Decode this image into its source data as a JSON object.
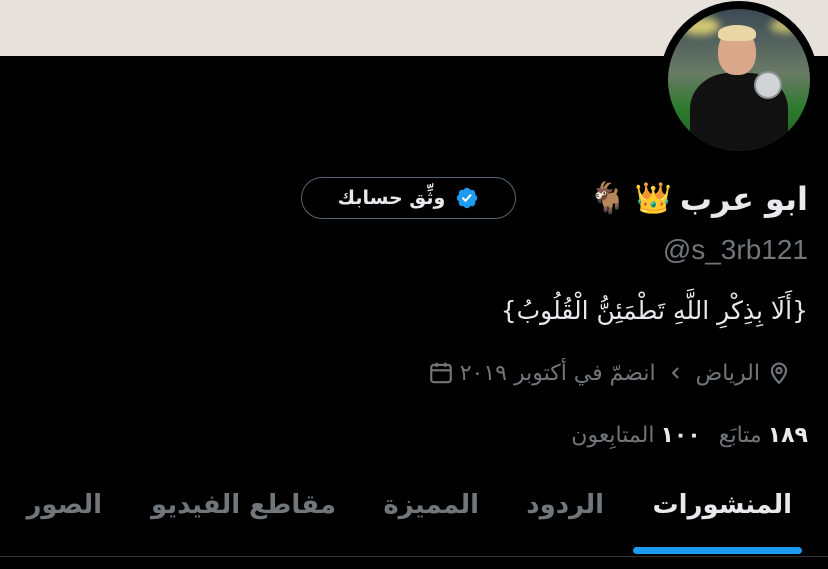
{
  "profile": {
    "display_name": "ابو عرب",
    "emoji_crown": "👑",
    "emoji_goat": "🐐",
    "handle": "@s_3rb121",
    "bio": "{أَلَا بِذِكْرِ اللَّهِ تَطْمَئِنُّ الْقُلُوبُ}",
    "location": "الرياض",
    "joined": "انضمّ في أكتوبر ٢٠١٩",
    "following_count": "١٨٩",
    "following_label": "متابَع",
    "followers_count": "١٠٠",
    "followers_label": "المتابِعون",
    "verify_button": "وثِّق حسابك"
  },
  "tabs": [
    {
      "label": "المنشورات",
      "active": true
    },
    {
      "label": "الردود",
      "active": false
    },
    {
      "label": "المميزة",
      "active": false
    },
    {
      "label": "مقاطع الفيديو",
      "active": false
    },
    {
      "label": "الصور",
      "active": false
    }
  ],
  "colors": {
    "background": "#000000",
    "text_primary": "#e7e9ea",
    "text_secondary": "#71767b",
    "accent": "#1d9bf0",
    "banner": "#e6e1da"
  },
  "icons": {
    "verified": "verified-badge-icon",
    "location": "location-pin-icon",
    "calendar": "calendar-icon",
    "chevron": "chevron-left-icon"
  }
}
